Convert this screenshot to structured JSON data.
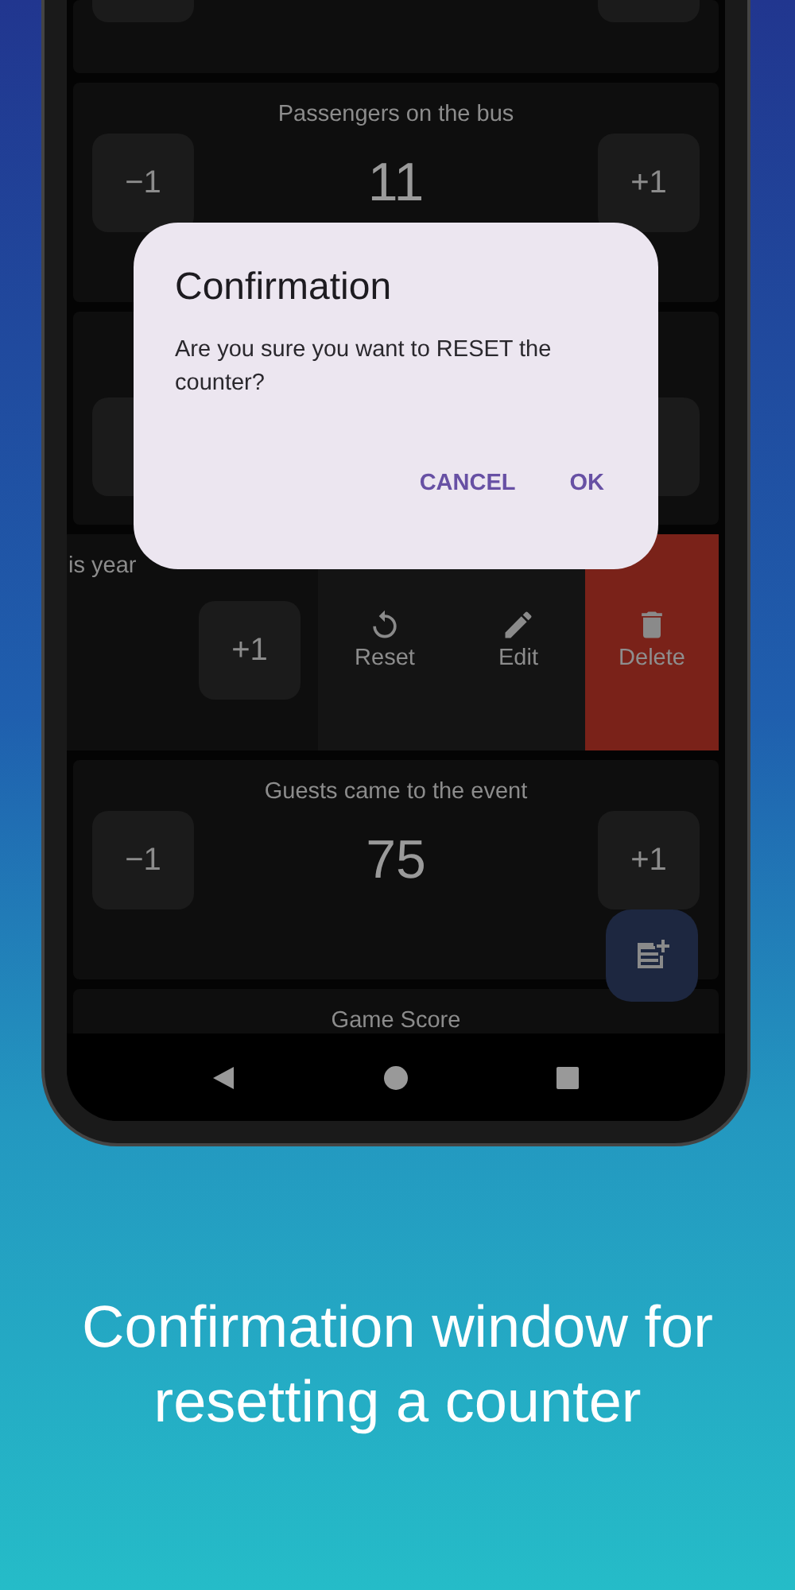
{
  "cards": [
    {
      "kind": "partial"
    },
    {
      "kind": "counter",
      "title": "Passengers on the bus",
      "value": "11",
      "minus": "−1",
      "plus": "+1"
    },
    {
      "kind": "hidden"
    },
    {
      "kind": "swiped",
      "title": "is year",
      "plus": "+1",
      "actions": [
        {
          "kind": "reset",
          "label": "Reset",
          "danger": false
        },
        {
          "kind": "edit",
          "label": "Edit",
          "danger": false
        },
        {
          "kind": "delete",
          "label": "Delete",
          "danger": true
        }
      ]
    },
    {
      "kind": "counter",
      "title": "Guests came to the event",
      "value": "75",
      "minus": "−1",
      "plus": "+1"
    },
    {
      "kind": "title",
      "title": "Game Score"
    }
  ],
  "dialog": {
    "title": "Confirmation",
    "message": "Are you sure you want to RESET the counter?",
    "buttons": [
      "CANCEL",
      "OK"
    ]
  },
  "caption": "Confirmation window for resetting a counter"
}
